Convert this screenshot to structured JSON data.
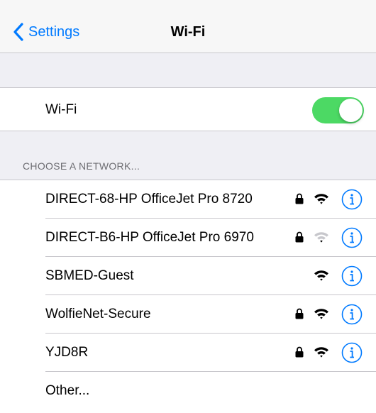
{
  "nav": {
    "back_label": "Settings",
    "title": "Wi-Fi"
  },
  "wifi": {
    "label": "Wi-Fi",
    "enabled": true
  },
  "section_header": "CHOOSE A NETWORK...",
  "networks": [
    {
      "name": "DIRECT-68-HP OfficeJet Pro 8720",
      "secured": true,
      "signal": "full"
    },
    {
      "name": "DIRECT-B6-HP OfficeJet Pro 6970",
      "secured": true,
      "signal": "weak"
    },
    {
      "name": "SBMED-Guest",
      "secured": false,
      "signal": "full"
    },
    {
      "name": "WolfieNet-Secure",
      "secured": true,
      "signal": "full"
    },
    {
      "name": "YJD8R",
      "secured": true,
      "signal": "full"
    },
    {
      "name": "Other..."
    }
  ],
  "colors": {
    "accent": "#007aff",
    "toggle_on": "#4cd964",
    "background": "#efeff4"
  }
}
